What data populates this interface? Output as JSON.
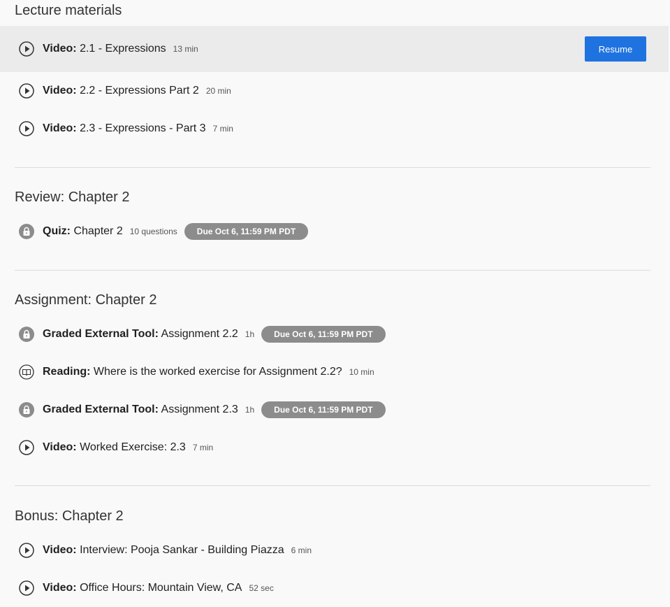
{
  "sections": [
    {
      "title": "Lecture materials",
      "items": [
        {
          "type": "Video:",
          "title": "2.1 - Expressions",
          "meta": "13 min",
          "icon": "play-icon",
          "action": "Resume"
        },
        {
          "type": "Video:",
          "title": "2.2 - Expressions Part 2",
          "meta": "20 min",
          "icon": "play-icon"
        },
        {
          "type": "Video:",
          "title": "2.3 - Expressions - Part 3",
          "meta": "7 min",
          "icon": "play-icon"
        }
      ]
    },
    {
      "title": "Review: Chapter 2",
      "items": [
        {
          "type": "Quiz:",
          "title": "Chapter 2",
          "meta": "10 questions",
          "icon": "lock-icon",
          "badge": "Due Oct 6, 11:59 PM PDT"
        }
      ]
    },
    {
      "title": "Assignment: Chapter 2",
      "items": [
        {
          "type": "Graded External Tool:",
          "title": "Assignment 2.2",
          "meta": "1h",
          "icon": "lock-icon",
          "badge": "Due Oct 6, 11:59 PM PDT"
        },
        {
          "type": "Reading:",
          "title": "Where is the worked exercise for Assignment 2.2?",
          "meta": "10 min",
          "icon": "book-icon"
        },
        {
          "type": "Graded External Tool:",
          "title": "Assignment 2.3",
          "meta": "1h",
          "icon": "lock-icon",
          "badge": "Due Oct 6, 11:59 PM PDT"
        },
        {
          "type": "Video:",
          "title": "Worked Exercise: 2.3",
          "meta": "7 min",
          "icon": "play-icon"
        }
      ]
    },
    {
      "title": "Bonus: Chapter 2",
      "items": [
        {
          "type": "Video:",
          "title": "Interview: Pooja Sankar - Building Piazza",
          "meta": "6 min",
          "icon": "play-icon"
        },
        {
          "type": "Video:",
          "title": "Office Hours: Mountain View, CA",
          "meta": "52 sec",
          "icon": "play-icon"
        }
      ]
    }
  ],
  "colors": {
    "accent": "#1f73e0",
    "badge": "#8c8c8c",
    "active_row": "#ebebeb",
    "background": "#f9f9f9"
  }
}
